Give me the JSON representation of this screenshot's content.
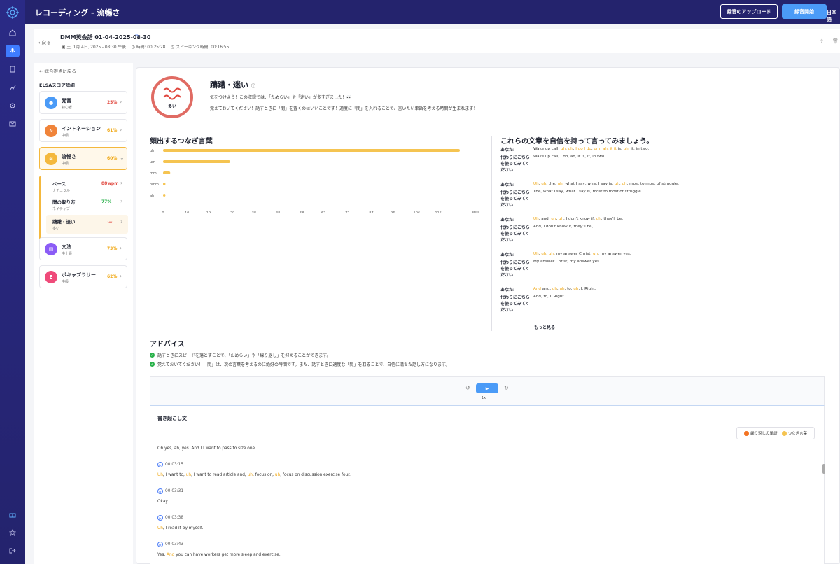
{
  "app": {
    "title": "レコーディング - 流暢さ",
    "upload_label": "録音のアップロード",
    "record_label": "録音開始",
    "language": "日本語"
  },
  "header": {
    "back": "戻る",
    "recording_title": "DMM英会話 01-04-2025-08-30",
    "date": "土, 1月 4日, 2025 - 08:30 午後",
    "duration": "時間: 00:25:28",
    "speaking_time": "スピーキング時間: 00:16:55"
  },
  "sidebar": {
    "back": "総合得点に戻る",
    "heading": "ELSAスコア詳細",
    "cards": [
      {
        "name": "発音",
        "level": "初心者",
        "score": "25%",
        "color": "#4b9bf7",
        "icon": "mic-icon",
        "score_color": "#e0463d"
      },
      {
        "name": "イントネーション",
        "level": "中級",
        "score": "61%",
        "color": "#f0843a",
        "icon": "wave-icon",
        "score_color": "#f0a712"
      },
      {
        "name": "流暢さ",
        "level": "中級",
        "score": "60%",
        "color": "#f4b83d",
        "icon": "fluency-icon",
        "score_color": "#f0a712"
      },
      {
        "name": "文法",
        "level": "中上級",
        "score": "73%",
        "color": "#8b5cf6",
        "icon": "grammar-icon",
        "score_color": "#f0a712"
      },
      {
        "name": "ボキャブラリー",
        "level": "中級",
        "score": "62%",
        "color": "#ef4b7a",
        "icon": "vocab-icon",
        "badge_text": "E",
        "score_color": "#f0a712"
      }
    ],
    "sub_items": [
      {
        "name": "ペース",
        "level": "ナチュラル",
        "value": "88wpm",
        "value_color": "#e0463d"
      },
      {
        "name": "間の取り方",
        "level": "ネイティブ",
        "value": "77%",
        "value_color": "#2bb24c"
      },
      {
        "name": "躊躇・迷い",
        "level": "多い",
        "value": "〰",
        "value_color": "#e0463d"
      }
    ]
  },
  "main": {
    "gauge_label": "多い",
    "title": "躊躇・迷い",
    "desc1": "気をつけよう！この収録では、「ためらい」や「迷い」が多すぎました！👀",
    "desc2": "覚えておいてください！話すときに「間」を置くのはいいことです！適度に「間」を入れることで、言いたい単語を考える時間が生まれます！",
    "filler_title": "頻出するつなぎ言葉",
    "sentences_title": "これらの文章を自信を持って言ってみましょう。",
    "you_label": "あなた:",
    "try_label": "代わりにこちらを使ってみてください：",
    "sentences": [
      {
        "you": "Wake up call, uh, uh, I do I do, um, ah, it it is, uh, it, in two.",
        "try": "Wake up call, I do, ah, it is, it, in two."
      },
      {
        "you": "Uh, uh, the, uh, what I say, what I say is, uh, uh, most to most of struggle.",
        "try": "The, what I say, what I say is, most to most of struggle."
      },
      {
        "you": "Uh, and, uh, uh, I don't know if, uh, they'll be,",
        "try": "And, I don't know if, they'll be,"
      },
      {
        "you": "Uh, uh, uh, my answer Christ, uh, my answer yes.",
        "try": "My answer Christ, my answer yes."
      },
      {
        "you": "And and, uh, uh, to, uh, I. Right.",
        "try": "And, to, I. Right."
      }
    ],
    "more": "もっと見る"
  },
  "advice": {
    "title": "アドバイス",
    "items": [
      "話すときにスピードを落とすことで、「ためらい」や「繰り返し」を抑えることができます。",
      "覚えておいてください！「間」は、次の言葉を考えるのに絶好の時間です。また、話すときに適度な「間」を取ることで、自信に満ちた話し方になります。"
    ]
  },
  "player": {
    "speed": "1x"
  },
  "transcript": {
    "title": "書き起こし文",
    "legend_repeat": "繰り返しの単語",
    "legend_filler": "つなぎ言葉",
    "first_line": "Oh yes, ah, yes. And I I want to pass to size one.",
    "entries": [
      {
        "time": "00:03:15",
        "text": "Uh, I want to, uh, I want to read article and, uh, focus on, uh, focus on discussion exercise four."
      },
      {
        "time": "00:03:31",
        "text": "Okay."
      },
      {
        "time": "00:03:38",
        "text": "Uh, I read it by myself."
      },
      {
        "time": "00:03:43",
        "text": "Yes. And you can have workers get more sleep and exercise."
      }
    ]
  },
  "chart_data": {
    "type": "bar",
    "orientation": "horizontal",
    "title": "頻出するつなぎ言葉",
    "categories": [
      "uh",
      "um",
      "mm",
      "hmm",
      "ah"
    ],
    "values": [
      124,
      28,
      3,
      1,
      1
    ],
    "xticks": [
      "0",
      "10",
      "19",
      "29",
      "38",
      "48",
      "58",
      "67",
      "77",
      "87",
      "96",
      "106",
      "115"
    ],
    "xunit": "時間",
    "xlim": [
      0,
      124
    ],
    "color": "#f5c451"
  }
}
